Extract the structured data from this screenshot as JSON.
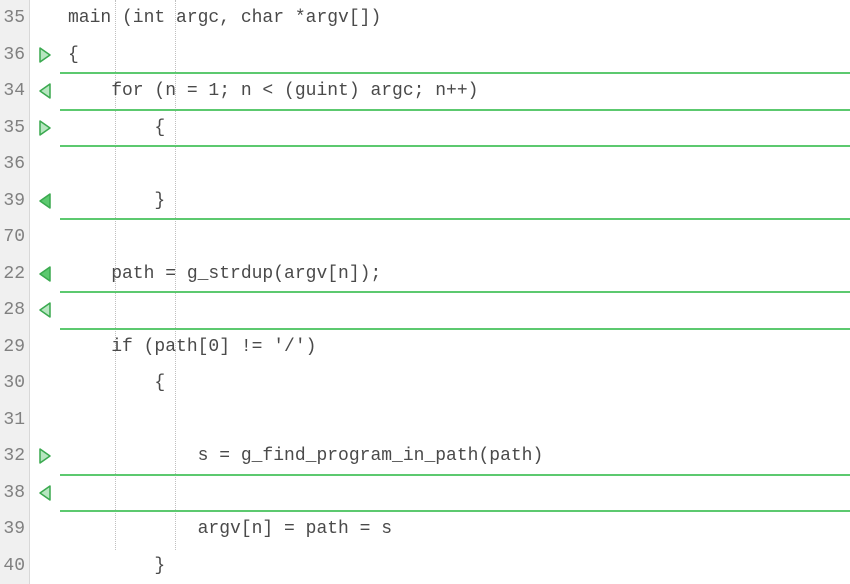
{
  "colors": {
    "fold_fill_open": "#b7e6c0",
    "fold_stroke": "#3aa94f",
    "fold_fill_closed": "#5cc96f"
  },
  "lines": [
    {
      "num": "35",
      "fold": "none",
      "bar": false,
      "code": "main (int argc, char *argv[])"
    },
    {
      "num": "36",
      "fold": "right-open",
      "bar": true,
      "code": "{"
    },
    {
      "num": "34",
      "fold": "left-open",
      "bar": true,
      "code": "    for (n = 1; n < (guint) argc; n++)"
    },
    {
      "num": "35",
      "fold": "right-open",
      "bar": true,
      "code": "        {"
    },
    {
      "num": "36",
      "fold": "none",
      "bar": false,
      "code": ""
    },
    {
      "num": "39",
      "fold": "left-closed",
      "bar": true,
      "code": "        }"
    },
    {
      "num": "70",
      "fold": "none",
      "bar": false,
      "code": ""
    },
    {
      "num": "22",
      "fold": "left-closed",
      "bar": true,
      "code": "    path = g_strdup(argv[n]);"
    },
    {
      "num": "28",
      "fold": "left-open",
      "bar": true,
      "code": ""
    },
    {
      "num": "29",
      "fold": "none",
      "bar": false,
      "code": "    if (path[0] != '/')"
    },
    {
      "num": "30",
      "fold": "none",
      "bar": false,
      "code": "        {"
    },
    {
      "num": "31",
      "fold": "none",
      "bar": false,
      "code": ""
    },
    {
      "num": "32",
      "fold": "right-open",
      "bar": true,
      "code": "            s = g_find_program_in_path(path)"
    },
    {
      "num": "38",
      "fold": "left-open",
      "bar": true,
      "code": ""
    },
    {
      "num": "39",
      "fold": "none",
      "bar": false,
      "code": "            argv[n] = path = s"
    },
    {
      "num": "40",
      "fold": "none",
      "bar": false,
      "code": "        }"
    }
  ]
}
